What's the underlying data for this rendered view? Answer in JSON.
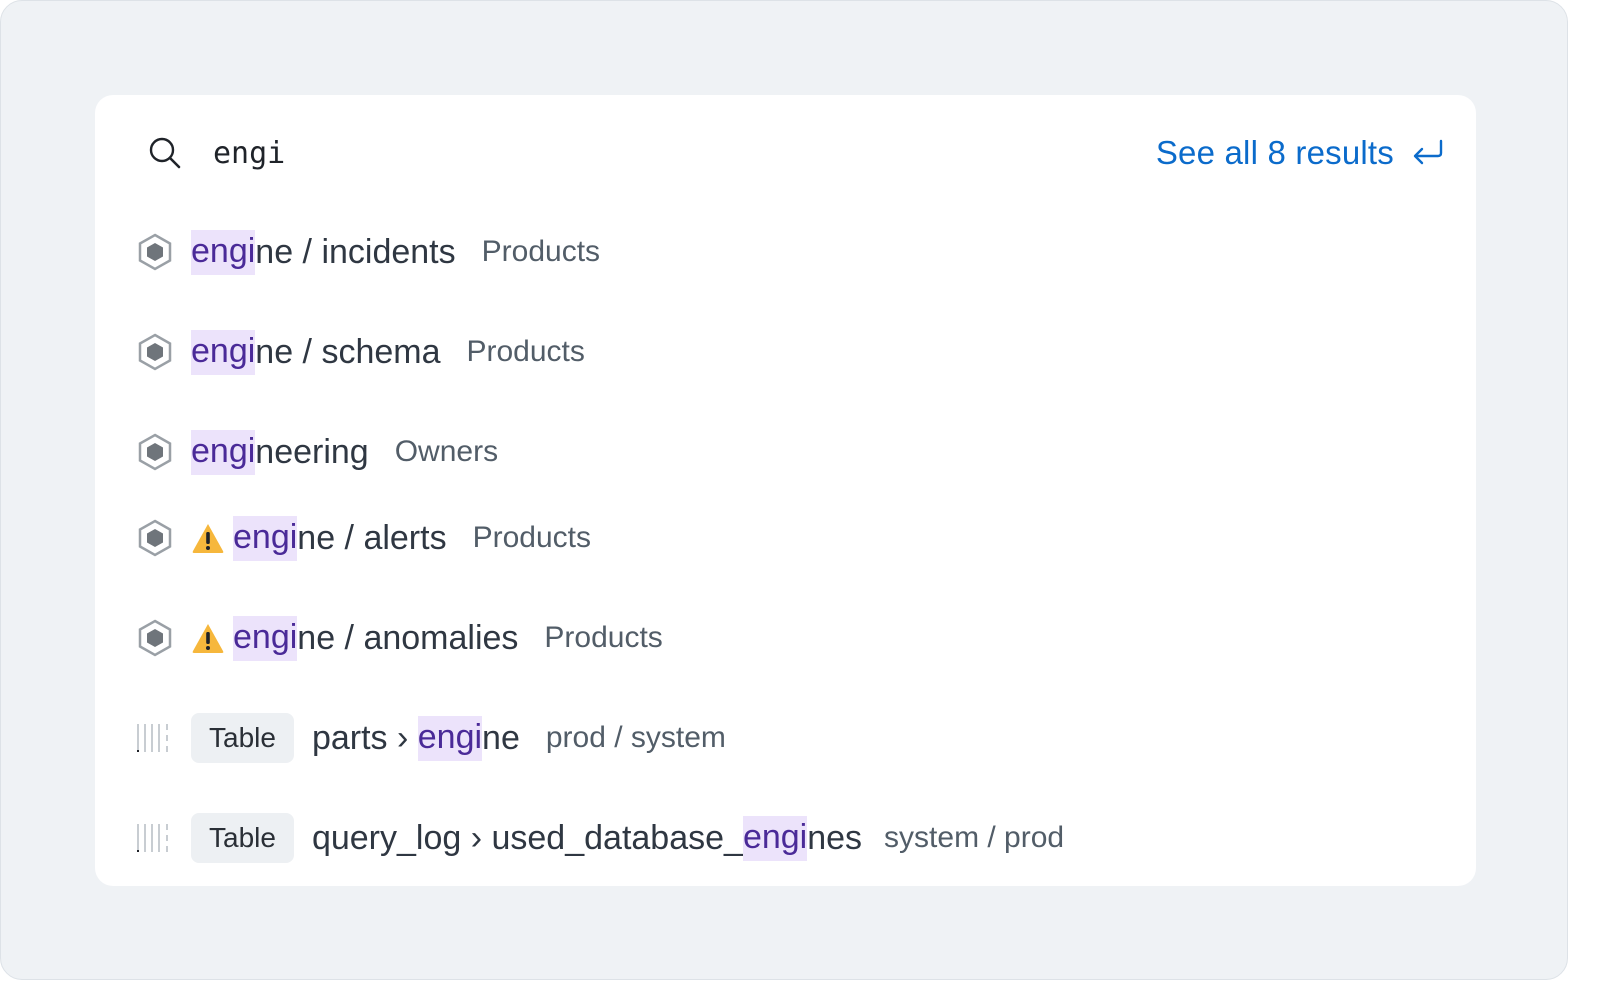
{
  "search": {
    "query": "engi",
    "see_all_label": "See all 8 results"
  },
  "results": [
    {
      "match": "engi",
      "rest": "ne / incidents",
      "meta": "Products"
    },
    {
      "match": "engi",
      "rest": "ne / schema",
      "meta": "Products"
    },
    {
      "match": "engi",
      "rest": "neering",
      "meta": "Owners"
    },
    {
      "match": "engi",
      "rest": "ne / alerts",
      "meta": "Products"
    },
    {
      "match": "engi",
      "rest": "ne / anomalies",
      "meta": "Products"
    },
    {
      "type": "Table",
      "prefix": "parts › ",
      "match": "engi",
      "rest": "ne",
      "meta": "prod / system"
    },
    {
      "type": "Table",
      "prefix": "query_log › used_database_",
      "match": "engi",
      "rest": "nes",
      "meta": "system / prod"
    }
  ],
  "icons": {
    "search": "search-icon",
    "return": "return-icon",
    "entity": "hexagon-icon",
    "warning": "warning-icon",
    "table": "table-columns-icon"
  },
  "colors": {
    "accent": "#0b6bcb",
    "highlight_bg": "#ece3fb",
    "highlight_text": "#4a2a98",
    "warning": "#f6b73c",
    "background": "#eff2f5"
  }
}
